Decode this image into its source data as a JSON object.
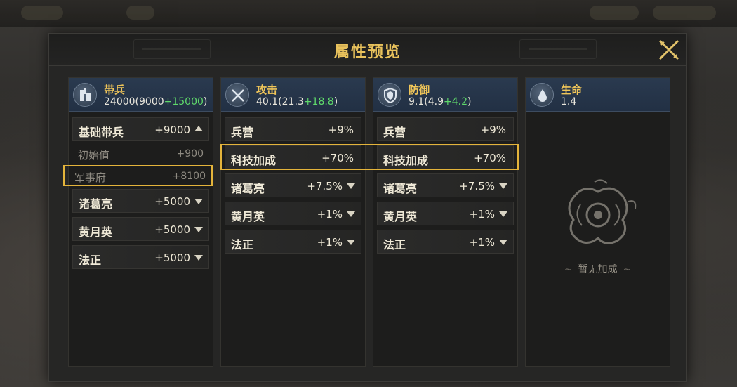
{
  "panel": {
    "title": "属性预览"
  },
  "columns": [
    {
      "name": "带兵",
      "icon": "soldier-icon",
      "value_main": "24000(9000",
      "value_bonus": "+15000",
      "value_end": ")",
      "rows": [
        {
          "label": "基础带兵",
          "value": "+9000",
          "arrow": "up",
          "expanded": true,
          "subrows": [
            {
              "label": "初始值",
              "value": "+900"
            },
            {
              "label": "军事府",
              "value": "+8100"
            }
          ]
        },
        {
          "label": "诸葛亮",
          "value": "+5000",
          "arrow": "down"
        },
        {
          "label": "黄月英",
          "value": "+5000",
          "arrow": "down"
        },
        {
          "label": "法正",
          "value": "+5000",
          "arrow": "down"
        }
      ]
    },
    {
      "name": "攻击",
      "icon": "crossed-swords-icon",
      "value_main": "40.1(21.3",
      "value_bonus": "+18.8",
      "value_end": ")",
      "rows": [
        {
          "label": "兵营",
          "value": "+9%"
        },
        {
          "label": "科技加成",
          "value": "+70%"
        },
        {
          "label": "诸葛亮",
          "value": "+7.5%",
          "arrow": "down"
        },
        {
          "label": "黄月英",
          "value": "+1%",
          "arrow": "down"
        },
        {
          "label": "法正",
          "value": "+1%",
          "arrow": "down"
        }
      ]
    },
    {
      "name": "防御",
      "icon": "shield-icon",
      "value_main": "9.1(4.9",
      "value_bonus": "+4.2",
      "value_end": ")",
      "rows": [
        {
          "label": "兵营",
          "value": "+9%"
        },
        {
          "label": "科技加成",
          "value": "+70%"
        },
        {
          "label": "诸葛亮",
          "value": "+7.5%",
          "arrow": "down"
        },
        {
          "label": "黄月英",
          "value": "+1%",
          "arrow": "down"
        },
        {
          "label": "法正",
          "value": "+1%",
          "arrow": "down"
        }
      ]
    },
    {
      "name": "生命",
      "icon": "droplet-icon",
      "value_main": "1.4",
      "empty_text": "暂无加成",
      "empty_icon": "dragon-emblem-icon"
    }
  ],
  "colors": {
    "accent_gold": "#e9c25c",
    "bonus_green": "#5fd96b",
    "highlight_border": "#e4b43b",
    "header_blue": "#2a3a4f"
  }
}
